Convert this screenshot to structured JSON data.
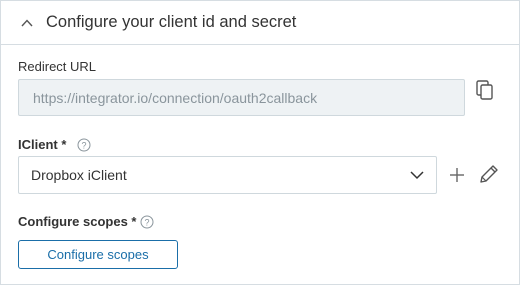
{
  "panel": {
    "title": "Configure your client id and secret",
    "collapse_icon": "chevron-up-icon"
  },
  "redirect_url": {
    "label": "Redirect URL",
    "value": "https://integrator.io/connection/oauth2callback",
    "copy_icon": "copy-icon"
  },
  "iclient": {
    "label": "IClient *",
    "help_icon": "help-icon",
    "selected": "Dropbox iClient",
    "dropdown_icon": "chevron-down-icon",
    "add_icon": "plus-icon",
    "edit_icon": "pencil-icon"
  },
  "scopes": {
    "label": "Configure scopes *",
    "help_icon": "help-icon",
    "button_label": "Configure scopes"
  },
  "colors": {
    "accent": "#1a6ea8",
    "border": "#d6dde2",
    "disabled_bg": "#eef2f4",
    "text": "#333333",
    "muted_text": "#8a959c"
  }
}
